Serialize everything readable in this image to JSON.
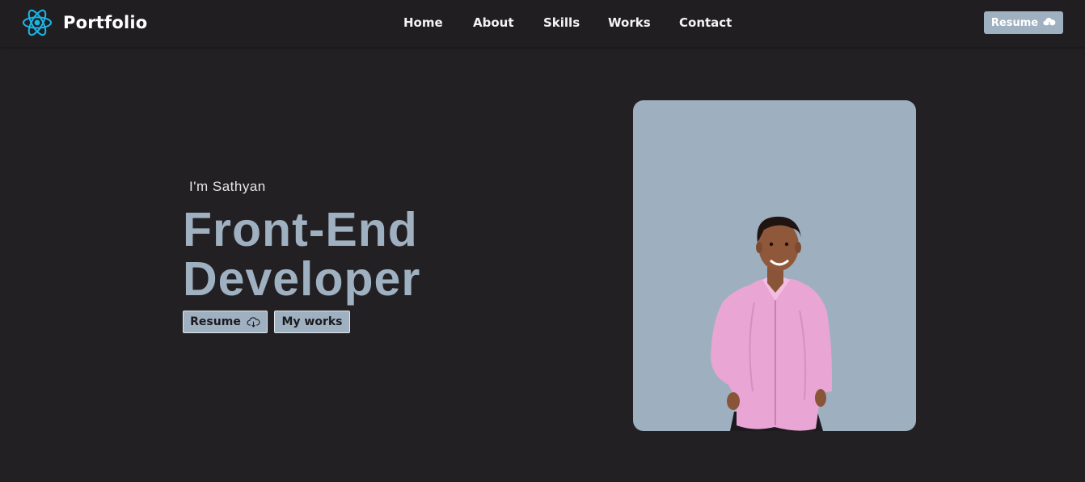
{
  "brand": {
    "name": "Portfolio",
    "icon": "react-atom-icon",
    "icon_color": "#1bb4e4"
  },
  "nav": {
    "links": [
      "Home",
      "About",
      "Skills",
      "Works",
      "Contact"
    ],
    "resume_label": "Resume",
    "resume_icon": "cloud-download-icon"
  },
  "hero": {
    "intro": "I'm Sathyan",
    "headline_line1": "Front-End",
    "headline_line2": "Developer",
    "resume_button": "Resume",
    "resume_button_icon": "cloud-download-icon",
    "works_button": "My works",
    "photo_alt": "profile-photo"
  },
  "colors": {
    "background": "#222022",
    "accent": "#9fb0c0",
    "text": "#ffffff"
  }
}
